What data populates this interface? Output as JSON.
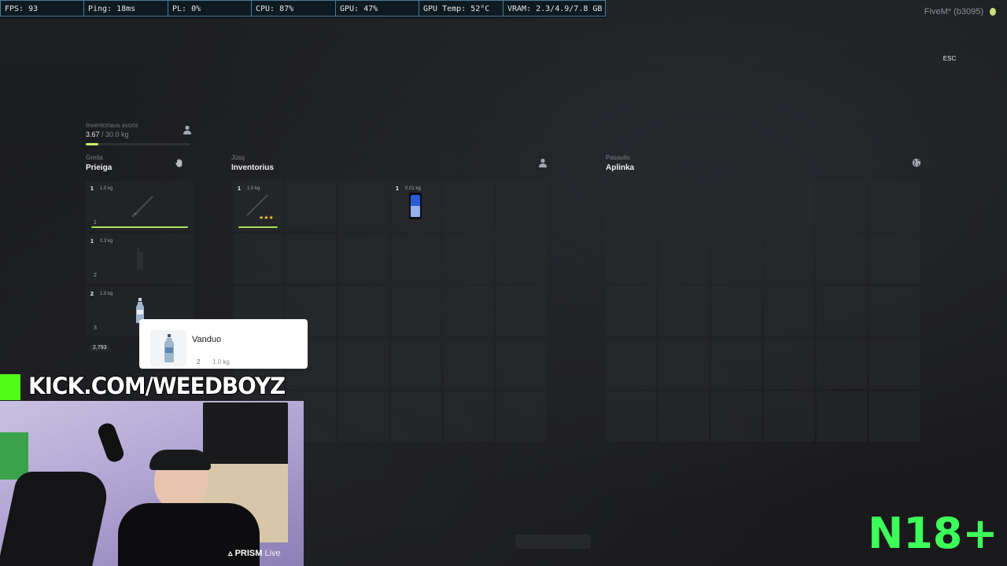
{
  "perf_bar": {
    "fps": "FPS: 93",
    "ping": "Ping: 18ms",
    "pl": "PL: 0%",
    "cpu": "CPU: 87%",
    "gpu": "GPU: 47%",
    "gpu_temp": "GPU Temp: 52°C",
    "vram": "VRAM: 2.3/4.9/7.8 GB"
  },
  "fivem_label": "FiveM* (b3095)",
  "esc_label": "ESC",
  "weight": {
    "label": "Inventoriaus svoris",
    "current": "3.67",
    "max": " / 30.0 kg",
    "fraction": 0.122
  },
  "quick": {
    "sub": "Greita",
    "title": "Prieiga",
    "slots": [
      {
        "count": "1",
        "weight": "1.0 kg",
        "index": "1",
        "item": "stick",
        "bar": true
      },
      {
        "count": "1",
        "weight": "0.3 kg",
        "index": "2",
        "item": "radio",
        "bar": false
      },
      {
        "count": "2",
        "weight": "1.0 kg",
        "index": "3",
        "item": "bottle",
        "bar": false
      }
    ],
    "money": "2,793"
  },
  "player_inv": {
    "sub": "Jūsų",
    "title": "Inventorius",
    "slots": [
      {
        "count": "1",
        "weight": "1.0 kg",
        "item": "stick",
        "stars": "★★★",
        "bar": true
      },
      {
        "count": "1",
        "weight": "0.01 kg",
        "item": "phone"
      }
    ]
  },
  "world": {
    "sub": "Pasaulio",
    "title": "Aplinka"
  },
  "tooltip": {
    "title": "Vanduo",
    "count": "2",
    "weight": "1.0 kg"
  },
  "stream": {
    "kick_text": "KICK.COM/WEEDBOYZ",
    "prism_brand": "PRISM",
    "prism_live": "Live",
    "age_badge": "N18+"
  },
  "colors": {
    "accent_green": "#c7f06a",
    "kick_green": "#53fc18",
    "n18_green": "#3dff5a",
    "star_gold": "#f2c230"
  }
}
